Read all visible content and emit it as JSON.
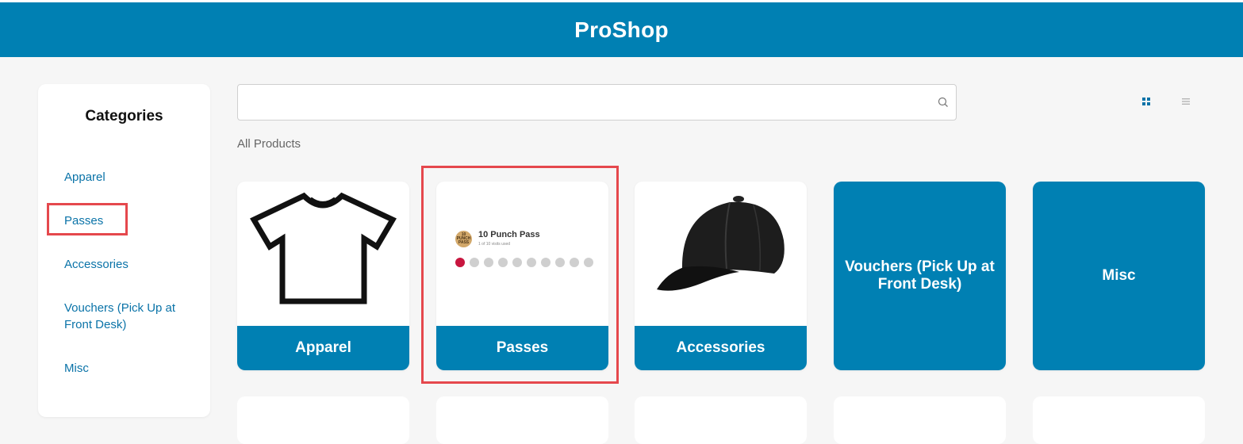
{
  "header": {
    "title": "ProShop"
  },
  "sidebar": {
    "title": "Categories",
    "items": [
      {
        "label": "Apparel"
      },
      {
        "label": "Passes"
      },
      {
        "label": "Accessories"
      },
      {
        "label": "Vouchers (Pick Up at Front Desk)"
      },
      {
        "label": "Misc"
      }
    ]
  },
  "search": {
    "value": "",
    "placeholder": "",
    "icon": "search-icon"
  },
  "view_toggle": {
    "grid_icon": "grid-view-icon",
    "list_icon": "list-view-icon",
    "active": "grid"
  },
  "breadcrumb": "All Products",
  "products": [
    {
      "label": "Apparel",
      "image": "t-shirt-icon"
    },
    {
      "label": "Passes",
      "image": "punch-pass",
      "pass": {
        "title": "10 Punch Pass",
        "sub": "1 of 10 visits used",
        "badge": "10 PUNCH PASS",
        "used": 1,
        "total": 10
      }
    },
    {
      "label": "Accessories",
      "image": "baseball-cap-icon"
    },
    {
      "label": "Vouchers (Pick Up at Front Desk)"
    },
    {
      "label": "Misc"
    }
  ],
  "colors": {
    "brand": "#0080b3",
    "link": "#0a73a8",
    "highlight": "#e5484d",
    "punch_used": "#c8163f"
  }
}
